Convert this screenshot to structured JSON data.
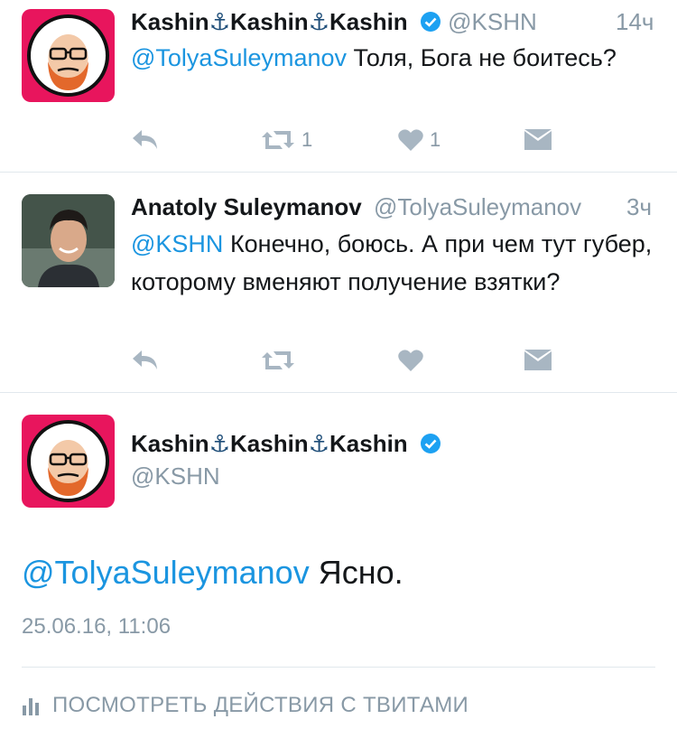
{
  "tweets": [
    {
      "name_parts": [
        "Kashin",
        "⚓",
        "Kashin",
        "⚓",
        "Kashin"
      ],
      "handle": "@KSHN",
      "time": "14ч",
      "mention": "@TolyaSuleymanov",
      "text": " Толя, Бога не боитесь?",
      "retweets": "1",
      "likes": "1"
    },
    {
      "name": "Anatoly Suleymanov",
      "handle": "@TolyaSuleymanov",
      "time": "3ч",
      "mention": "@KSHN",
      "text": " Конечно, боюсь. А при чем тут губер, которому вменяют получение взятки?"
    }
  ],
  "focused": {
    "name_parts": [
      "Kashin",
      "⚓",
      "Kashin",
      "⚓",
      "Kashin"
    ],
    "handle": "@KSHN",
    "mention": "@TolyaSuleymanov",
    "text": " Ясно.",
    "timestamp": "25.06.16, 11:06",
    "activity_label": "ПОСМОТРЕТЬ ДЕЙСТВИЯ С ТВИТАМИ"
  },
  "colors": {
    "link": "#1b95e0",
    "muted": "#8899a6",
    "icon": "#a8b6c2",
    "verified": "#1da1f2",
    "avatar_bg": "#e8155d"
  }
}
